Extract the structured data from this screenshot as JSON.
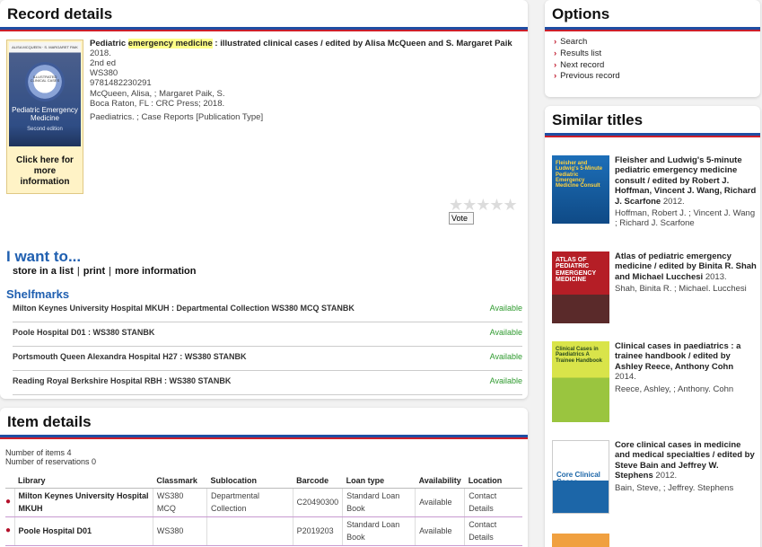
{
  "record": {
    "heading": "Record details",
    "cover": {
      "editors": "ALISA MCQUEEN · S. MARGARET PAIK",
      "badge": "ILLUSTRATED CLINICAL CASES",
      "title": "Pediatric Emergency Medicine",
      "edition": "Second edition",
      "link": "Click here for more information"
    },
    "title_pre": "Pediatric ",
    "title_highlight": "emergency medicine",
    "title_post": " : illustrated clinical cases / edited by Alisa McQueen and S. Margaret Paik",
    "year": "2018.",
    "edition": "2nd ed",
    "classmark": "WS380",
    "isbn": "9781482230291",
    "authors": "McQueen, Alisa, ; Margaret Paik, S.",
    "publisher": "Boca Raton, FL : CRC Press; 2018.",
    "subjects": "Paediatrics. ; Case Reports [Publication Type]",
    "stars": "★★★★★",
    "vote_label": "Vote",
    "iwant_heading": "I want to...",
    "iwant_links": [
      "store in a list",
      "print",
      "more information"
    ],
    "shelfmarks_heading": "Shelfmarks",
    "shelfmarks": [
      {
        "location": "Milton Keynes University Hospital MKUH : Departmental Collection WS380 MCQ STANBK",
        "status": "Available"
      },
      {
        "location": "Poole Hospital D01 : WS380 STANBK",
        "status": "Available"
      },
      {
        "location": "Portsmouth Queen Alexandra Hospital H27 : WS380 STANBK",
        "status": "Available"
      },
      {
        "location": "Reading Royal Berkshire Hospital RBH : WS380 STANBK",
        "status": "Available"
      }
    ]
  },
  "items": {
    "heading": "Item details",
    "count_items": "Number of items 4",
    "count_reservations": "Number of reservations 0",
    "columns": [
      "Library",
      "Classmark",
      "Sublocation",
      "Barcode",
      "Loan type",
      "Availability",
      "Location"
    ],
    "rows": [
      {
        "library": "Milton Keynes University Hospital MKUH",
        "classmark": "WS380 MCQ",
        "sublocation": "Departmental Collection",
        "barcode": "C20490300",
        "loan_type": "Standard Loan Book",
        "availability": "Available",
        "location": "Contact Details"
      },
      {
        "library": "Poole Hospital D01",
        "classmark": "WS380",
        "sublocation": "",
        "barcode": "P2019203",
        "loan_type": "Standard Loan Book",
        "availability": "Available",
        "location": "Contact Details"
      }
    ]
  },
  "options": {
    "heading": "Options",
    "items": [
      "Search",
      "Results list",
      "Next record",
      "Previous record"
    ]
  },
  "similar": {
    "heading": "Similar titles",
    "items": [
      {
        "title": "Fleisher and Ludwig's 5-minute pediatric emergency medicine consult / edited by Robert J. Hoffman, Vincent J. Wang, Richard J. Scarfone",
        "year": "2012.",
        "authors": "Hoffman, Robert J. ; Vincent J. Wang ; Richard J. Scarfone",
        "cover_label": "Fleisher and Ludwig's 5-Minute Pediatric Emergency Medicine Consult"
      },
      {
        "title": "Atlas of pediatric emergency medicine / edited by Binita R. Shah and Michael Lucchesi",
        "year": "2013.",
        "authors": "Shah, Binita R. ; Michael. Lucchesi",
        "cover_label": "ATLAS OF PEDIATRIC EMERGENCY MEDICINE"
      },
      {
        "title": "Clinical cases in paediatrics : a trainee handbook / edited by Ashley Reece, Anthony Cohn",
        "year": "2014.",
        "authors": "Reece, Ashley, ; Anthony. Cohn",
        "cover_label": "Clinical Cases in Paediatrics A Trainee Handbook"
      },
      {
        "title": "Core clinical cases in medicine and medical specialties / edited by Steve Bain and Jeffrey W. Stephens",
        "year": "2012.",
        "authors": "Bain, Steve, ; Jeffrey. Stephens",
        "cover_label": "Core Clinical Cases"
      }
    ]
  }
}
